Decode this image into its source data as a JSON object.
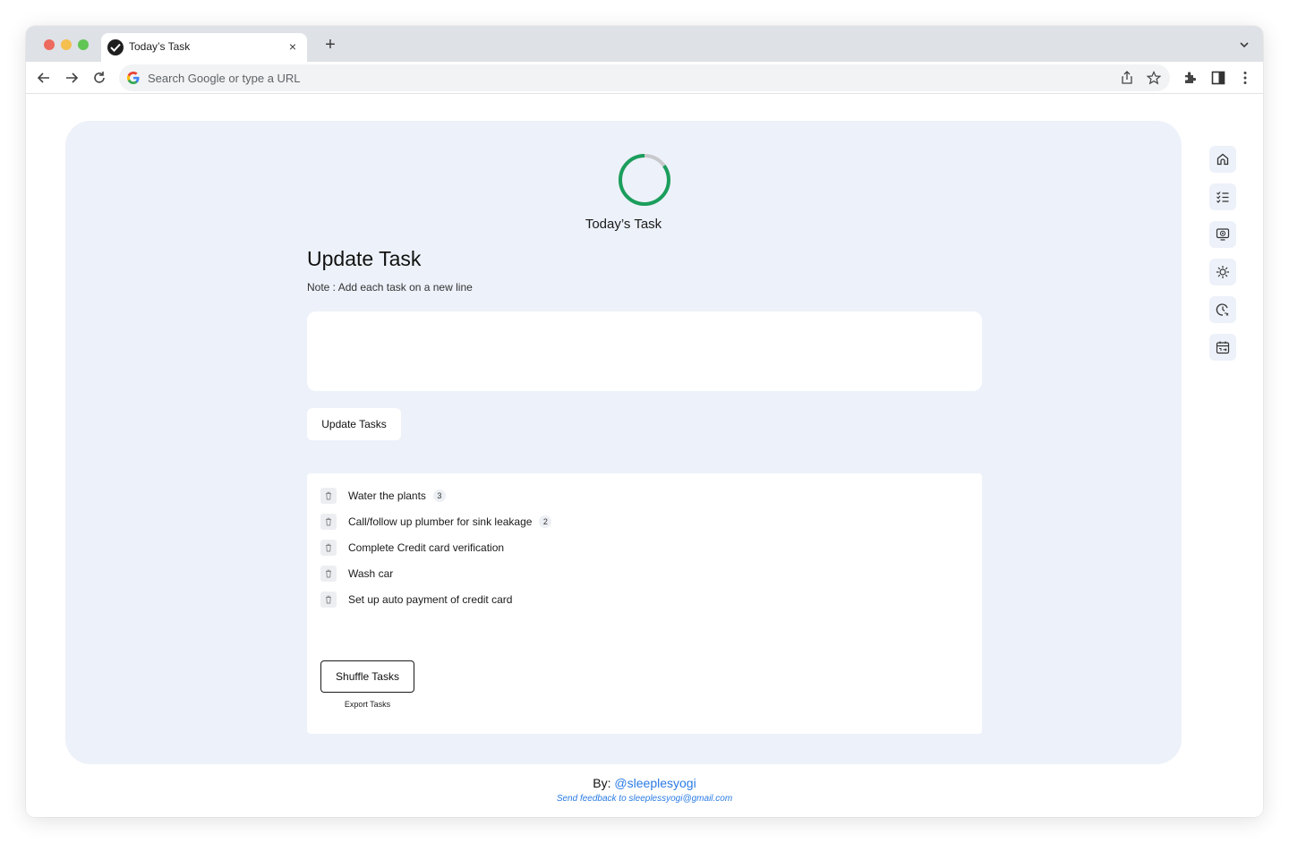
{
  "browser": {
    "tab_title": "Today’s Task",
    "tab_close": "×",
    "new_tab": "+",
    "omnibox_placeholder": "Search Google or type a URL"
  },
  "app": {
    "title": "Today’s Task",
    "progress_ring": {
      "fraction": 0.85,
      "color_done": "#1a9e5c",
      "color_remaining": "#c7c9cc"
    },
    "heading": "Update Task",
    "note": "Note : Add each task on a new line",
    "textarea_value": "",
    "update_button": "Update Tasks",
    "tasks": [
      {
        "text": "Water the plants",
        "badge": "3"
      },
      {
        "text": "Call/follow up plumber for sink leakage",
        "badge": "2"
      },
      {
        "text": "Complete Credit card verification",
        "badge": ""
      },
      {
        "text": "Wash car",
        "badge": ""
      },
      {
        "text": "Set up auto payment of credit card",
        "badge": ""
      }
    ],
    "shuffle_button": "Shuffle Tasks",
    "export_link": "Export Tasks"
  },
  "side_rail": [
    "home-icon",
    "checklist-icon",
    "monitor-icon",
    "sun-icon",
    "timer-icon",
    "calendar-icon"
  ],
  "footer": {
    "by_label": "By:",
    "handle": "@sleeplesyogi",
    "feedback": "Send feedback to sleeplessyogi@gmail.com"
  },
  "colors": {
    "panel": "#edf1f9",
    "link": "#2a7be4",
    "accent_green": "#1a9e5c"
  }
}
